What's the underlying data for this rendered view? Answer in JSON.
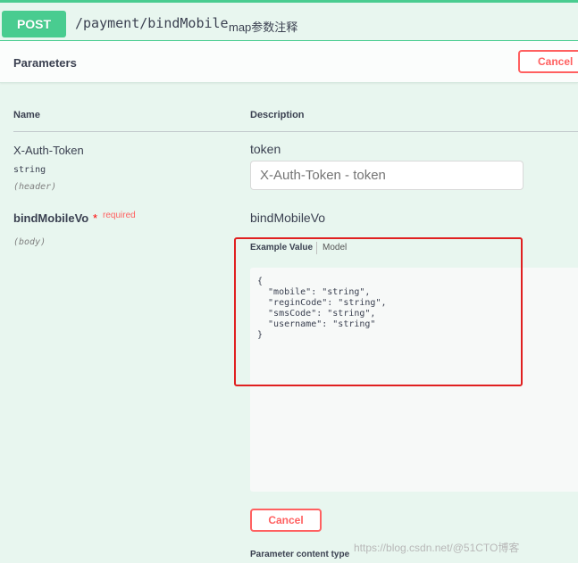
{
  "summary": {
    "method": "POST",
    "path": "/payment/bindMobile",
    "description": "map参数注释"
  },
  "section": {
    "title": "Parameters",
    "cancel_label": "Cancel"
  },
  "table": {
    "name_header": "Name",
    "description_header": "Description"
  },
  "params": [
    {
      "name": "X-Auth-Token",
      "type": "string",
      "in": "(header)",
      "description": "token",
      "placeholder": "X-Auth-Token - token"
    },
    {
      "name": "bindMobileVo",
      "required_star": "*",
      "required_label": "required",
      "in": "(body)",
      "description": "bindMobileVo"
    }
  ],
  "body_tabs": {
    "example": "Example Value",
    "model": "Model"
  },
  "example_json": "{\n  \"mobile\": \"string\",\n  \"reginCode\": \"string\",\n  \"smsCode\": \"string\",\n  \"username\": \"string\"\n}",
  "footer": {
    "cancel_label": "Cancel",
    "content_type_label": "Parameter content type"
  },
  "watermark": "https://blog.csdn.net/@51CTO博客",
  "colors": {
    "post": "#49cc90",
    "cancel": "#ff6060",
    "highlight": "#e02020",
    "background": "#e8f6ef"
  }
}
